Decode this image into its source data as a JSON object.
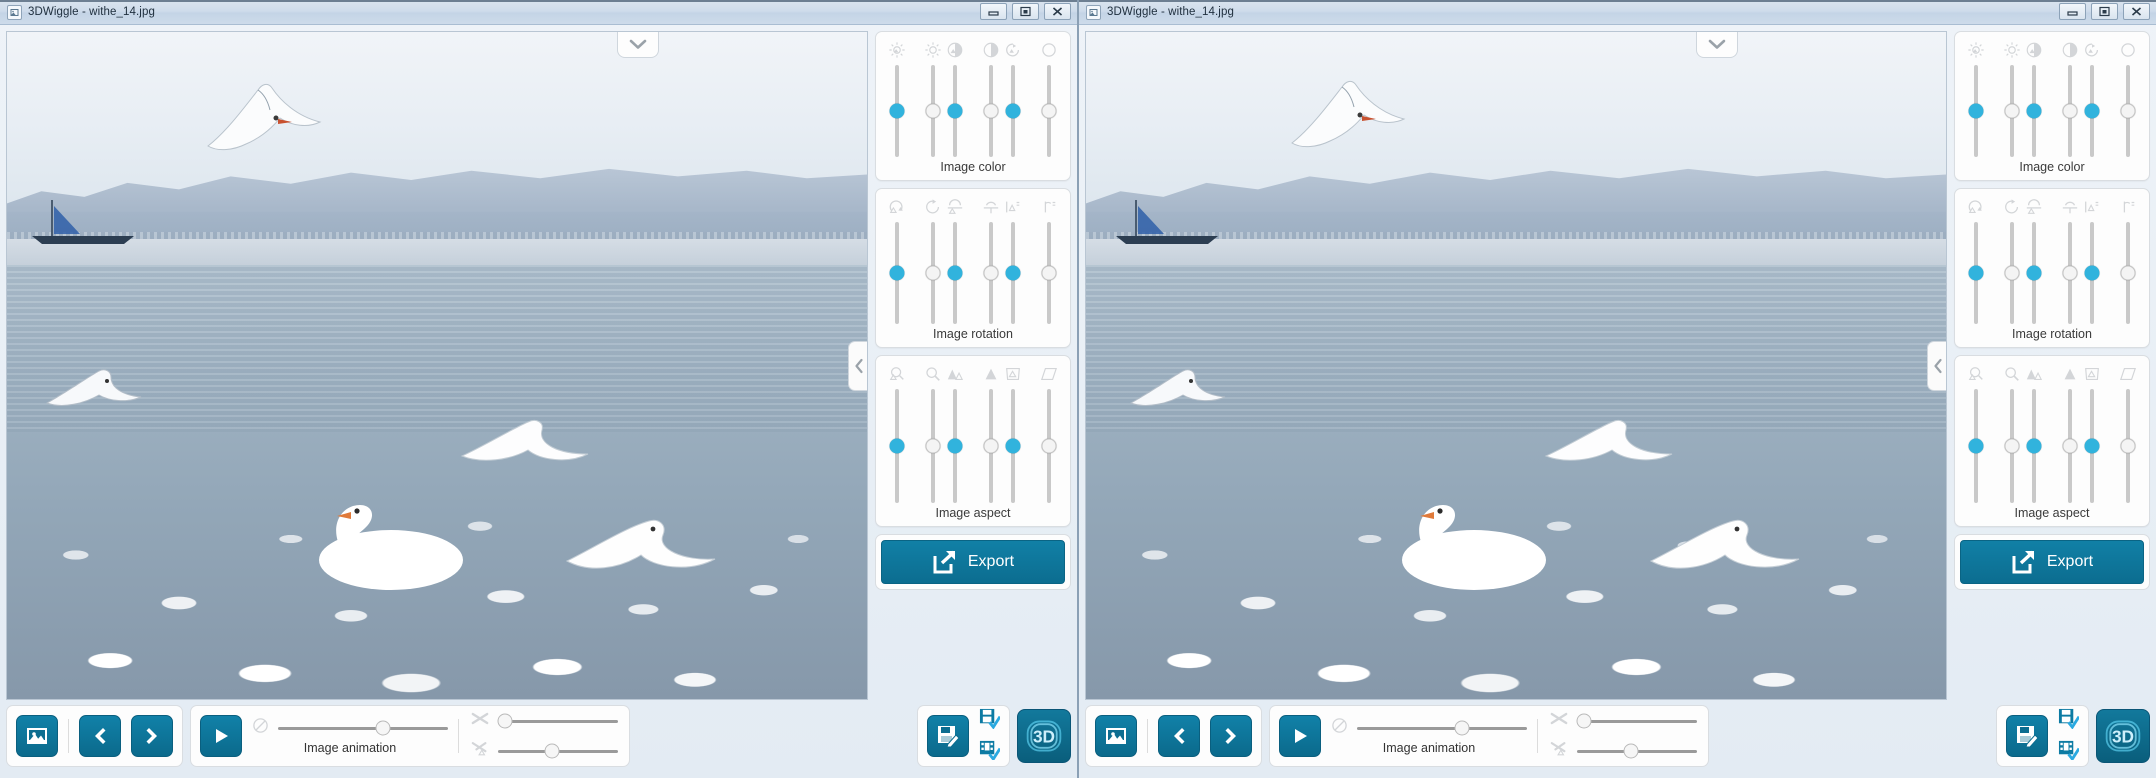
{
  "app": {
    "title": "3DWiggle - withe_14.jpg",
    "filename": "withe_14.jpg",
    "accent_color": "#0c6d90",
    "slider_active_color": "#31b3dd",
    "window_count": 2
  },
  "titlebar": {
    "app_icon": "app-image-icon",
    "minimize_label": "Minimize",
    "maximize_label": "Restore",
    "close_label": "Close"
  },
  "viewer": {
    "collapse_top_icon": "chevron-down-icon",
    "collapse_side_icon": "chevron-left-icon",
    "image_description": "Lake shore with many seagulls and swans in foreground, boats and hills in background"
  },
  "panels": [
    {
      "id": "image-color",
      "label": "Image color",
      "sliders": [
        {
          "icon": "brightness-low-icon",
          "value": 50,
          "state": "active"
        },
        {
          "icon": "brightness-high-icon",
          "value": 50,
          "state": "inactive"
        },
        {
          "icon": "contrast-half-icon",
          "value": 50,
          "state": "active"
        },
        {
          "icon": "contrast-full-icon",
          "value": 50,
          "state": "inactive"
        },
        {
          "icon": "saturation-left-icon",
          "value": 50,
          "state": "active"
        },
        {
          "icon": "saturation-right-icon",
          "value": 50,
          "state": "inactive"
        }
      ]
    },
    {
      "id": "image-rotation",
      "label": "Image rotation",
      "sliders": [
        {
          "icon": "rotate-image-icon",
          "value": 50,
          "state": "active"
        },
        {
          "icon": "rotate-icon",
          "value": 50,
          "state": "inactive"
        },
        {
          "icon": "flip-horizontal-image-icon",
          "value": 50,
          "state": "active"
        },
        {
          "icon": "flip-horizontal-icon",
          "value": 50,
          "state": "inactive"
        },
        {
          "icon": "flip-vertical-image-icon",
          "value": 50,
          "state": "active"
        },
        {
          "icon": "flip-vertical-icon",
          "value": 50,
          "state": "inactive"
        }
      ]
    },
    {
      "id": "image-aspect",
      "label": "Image aspect",
      "sliders": [
        {
          "icon": "zoom-image-icon",
          "value": 50,
          "state": "active"
        },
        {
          "icon": "zoom-icon",
          "value": 50,
          "state": "inactive"
        },
        {
          "icon": "scale-image-icon",
          "value": 50,
          "state": "active"
        },
        {
          "icon": "scale-icon",
          "value": 50,
          "state": "inactive"
        },
        {
          "icon": "skew-image-icon",
          "value": 50,
          "state": "active"
        },
        {
          "icon": "skew-icon",
          "value": 50,
          "state": "inactive"
        }
      ]
    }
  ],
  "export": {
    "label": "Export",
    "icon": "export-arrow-icon"
  },
  "bottom_bar": {
    "open_image_button": {
      "icon": "picture-icon",
      "label": "Open image"
    },
    "prev_button": {
      "icon": "chevron-left-icon",
      "label": "Previous"
    },
    "next_button": {
      "icon": "chevron-right-icon",
      "label": "Next"
    },
    "play_button": {
      "icon": "play-icon",
      "label": "Play"
    },
    "animation": {
      "label": "Image animation",
      "disabled_icon": "no-entry-icon",
      "slider_value": 62
    },
    "cross_sliders": [
      {
        "icon": "shuffle-icon",
        "value": 6
      },
      {
        "icon": "shuffle-image-icon",
        "value": 45
      }
    ],
    "save_button": {
      "icon": "save-edit-icon",
      "label": "Save / edit"
    },
    "save_check_button": {
      "icon": "save-check-icon",
      "label": "Save confirm"
    },
    "film_check_button": {
      "icon": "film-check-icon",
      "label": "Film confirm"
    },
    "three_d_button": {
      "icon": "3d-icon",
      "label": "3D"
    }
  }
}
